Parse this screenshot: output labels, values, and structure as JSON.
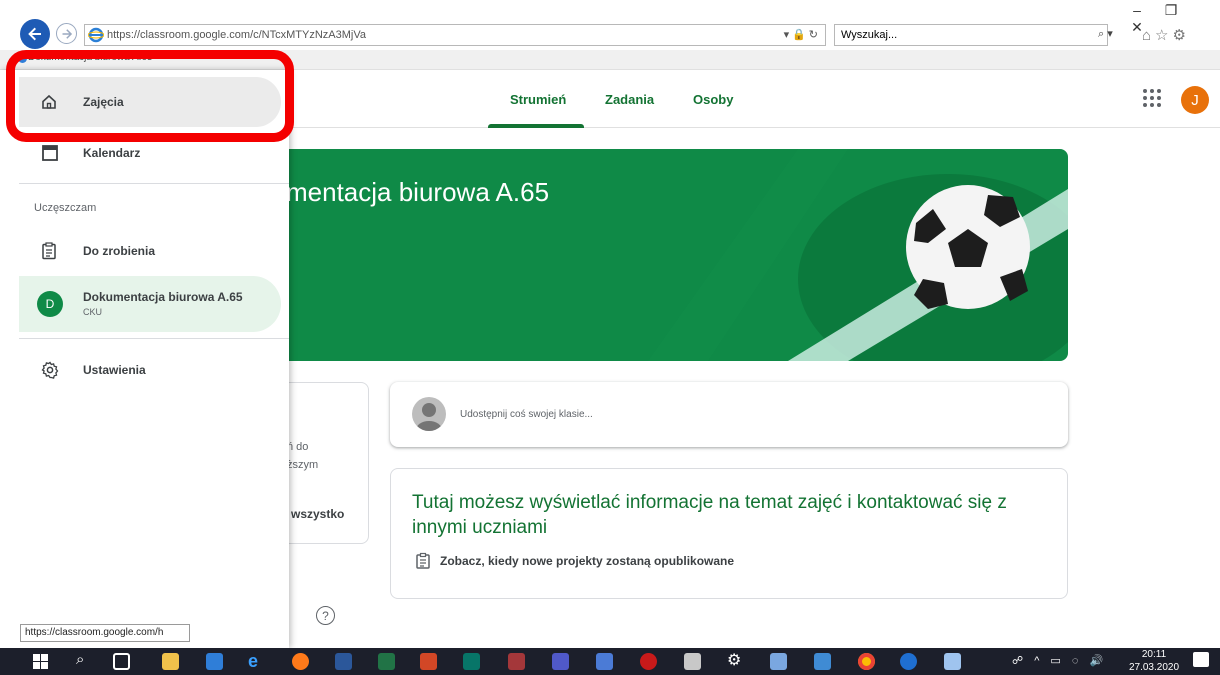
{
  "browser": {
    "url": "https://classroom.google.com/c/NTcxMTYzNzA3MjVa",
    "search_placeholder": "Wyszukaj...",
    "tab_title": "Dokumentacja biurowa A.65",
    "status_url": "https://classroom.google.com/h"
  },
  "header": {
    "tabs": [
      {
        "label": "Strumień"
      },
      {
        "label": "Zadania"
      },
      {
        "label": "Osoby"
      }
    ],
    "avatar_letter": "J"
  },
  "drawer": {
    "classes": "Zajęcia",
    "calendar": "Kalendarz",
    "section": "Uczęszczam",
    "todo": "Do zrobienia",
    "course": {
      "letter": "D",
      "name": "Dokumentacja biurowa A.65",
      "sub": "CKU"
    },
    "settings": "Ustawienia"
  },
  "banner": {
    "title": "mentacja biurowa A.65"
  },
  "upcoming": {
    "line1": "ń do",
    "line2": "ższym",
    "view_all": "wszystko"
  },
  "share": {
    "placeholder": "Udostępnij coś swojej klasie..."
  },
  "info": {
    "title": "Tutaj możesz wyświetlać informacje na temat zajęć i kontaktować się z innymi uczniami",
    "line": "Zobacz, kiedy nowe projekty zostaną opublikowane"
  },
  "taskbar": {
    "time": "20:11",
    "date": "27.03.2020"
  },
  "colors": {
    "accent_green": "#137333",
    "banner_green": "#0f8a47",
    "highlight_red": "#f40000"
  }
}
